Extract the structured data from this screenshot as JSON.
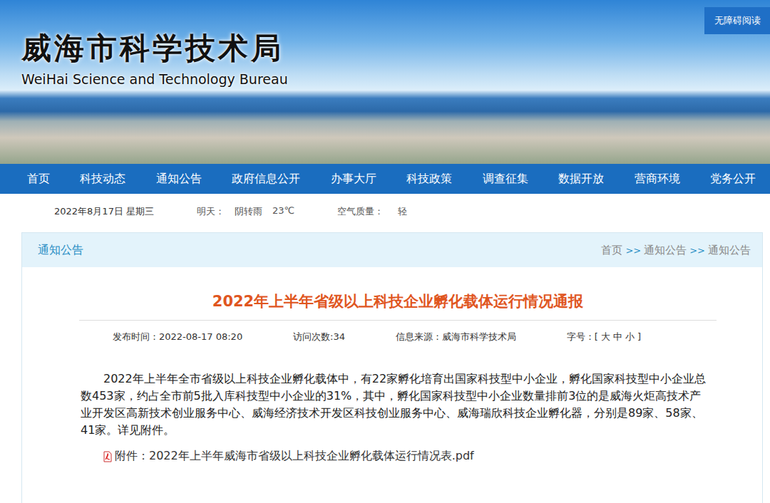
{
  "header": {
    "title": "威海市科学技术局",
    "subtitle": "WeiHai Science and Technology Bureau",
    "accessibility_button": "无障碍阅读"
  },
  "nav": {
    "items": [
      "首页",
      "科技动态",
      "通知公告",
      "政府信息公开",
      "办事大厅",
      "科技政策",
      "调查征集",
      "数据开放",
      "营商环境",
      "党务公开"
    ]
  },
  "info_bar": {
    "date": "2022年8月17日 星期三",
    "weather": [
      "明天：",
      "阴转雨",
      "23℃"
    ],
    "air_quality_label": "空气质量：",
    "air_quality": "轻"
  },
  "section": {
    "title": "通知公告",
    "breadcrumb": [
      {
        "label": "首页",
        "sep": ">>"
      },
      {
        "label": "通知公告",
        "sep": ">>"
      },
      {
        "label": "通知公告",
        "sep": ""
      }
    ]
  },
  "article": {
    "title": "2022年上半年省级以上科技企业孵化载体运行情况通报",
    "meta": {
      "published": "发布时间：2022-08-17 08:20",
      "visits": "访问次数:34",
      "source": "信息来源：威海市科学技术局",
      "font_size_label": "字号：[",
      "font_sizes": [
        "大",
        "中",
        "小"
      ],
      "font_size_close": "]"
    },
    "body": "2022年上半年全市省级以上科技企业孵化载体中，有22家孵化培育出国家科技型中小企业，孵化国家科技型中小企业总数453家，约占全市前5批入库科技型中小企业的31%，其中，孵化国家科技型中小企业数量排前3位的是威海火炬高技术产业开发区高新技术创业服务中心、威海经济技术开发区科技创业服务中心、威海瑞欣科技企业孵化器，分别是89家、58家、41家。详见附件。",
    "attachment": "附件：2022年上半年威海市省级以上科技企业孵化载体运行情况表.pdf"
  }
}
